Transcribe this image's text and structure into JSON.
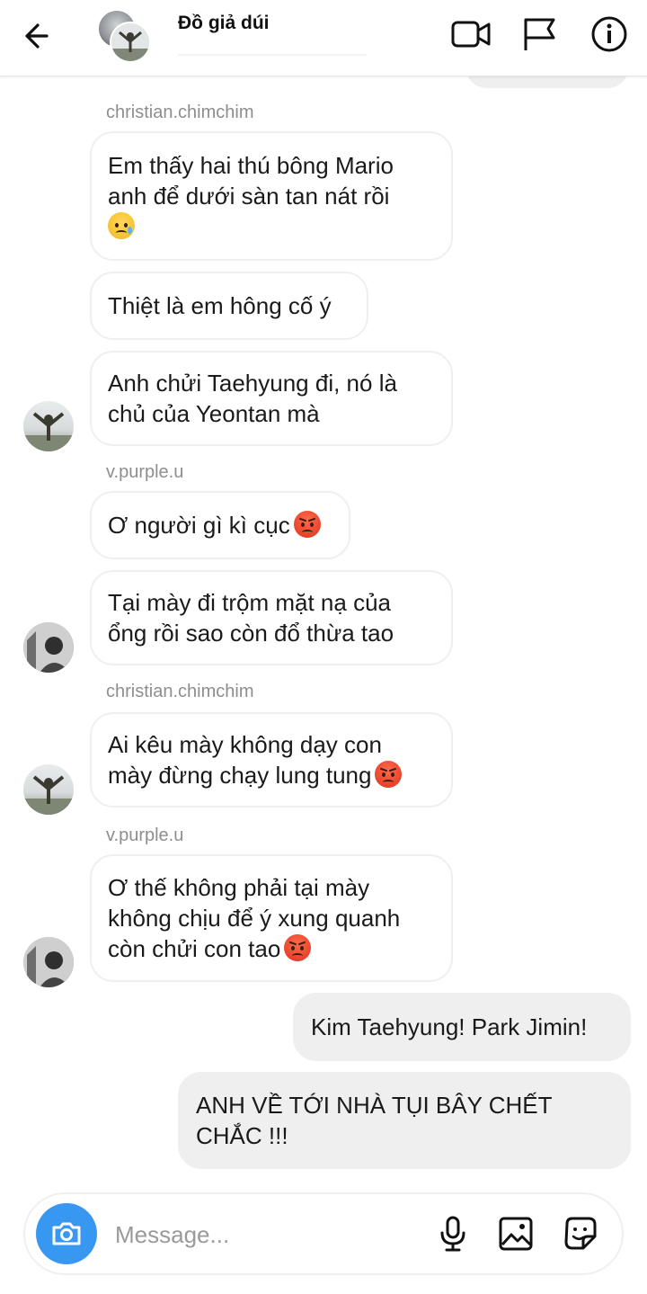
{
  "header": {
    "title": "Đồ giả dúi",
    "icons": [
      "back-arrow-icon",
      "video-call-icon",
      "flag-icon",
      "info-icon"
    ]
  },
  "messages": [
    {
      "sender": "christian.chimchim",
      "lines": [
        "Em thấy hai thú bông Mario",
        "anh để dưới sàn tan nát rồi"
      ],
      "emoji": "crying-smile-emoji"
    },
    {
      "lines": [
        "Thiệt là em hông cố ý"
      ]
    },
    {
      "lines": [
        "Anh chửi Taehyung đi, nó là",
        "chủ của Yeontan mà"
      ]
    },
    {
      "sender": "v.purple.u",
      "lines": [
        "Ơ người gì kì cục"
      ],
      "emoji": "angry-face-emoji"
    },
    {
      "lines": [
        "Tại mày đi trộm mặt nạ của",
        "ổng rồi sao còn đổ thừa tao"
      ]
    },
    {
      "sender": "christian.chimchim",
      "lines": [
        "Ai kêu mày không dạy con",
        "mày đừng chạy lung tung"
      ],
      "emoji": "angry-face-emoji"
    },
    {
      "sender": "v.purple.u",
      "lines": [
        "Ơ thế không phải tại mày",
        "không chịu để ý xung quanh",
        "còn chửi con tao"
      ],
      "emoji": "angry-face-emoji"
    },
    {
      "outgoing": true,
      "lines": [
        "Kim Taehyung! Park Jimin!"
      ]
    },
    {
      "outgoing": true,
      "lines": [
        "ANH VỀ TỚI NHÀ TỤI BÂY CHẾT",
        "CHẮC !!!"
      ]
    }
  ],
  "composer": {
    "placeholder": "Message...",
    "icons": [
      "camera-icon",
      "microphone-icon",
      "gallery-icon",
      "sticker-icon"
    ]
  },
  "colors": {
    "accent_blue": "#3897f0",
    "bubble_border": "#efefef",
    "outgoing_bubble": "#efefef",
    "sender_gray": "#8e8e8e"
  }
}
